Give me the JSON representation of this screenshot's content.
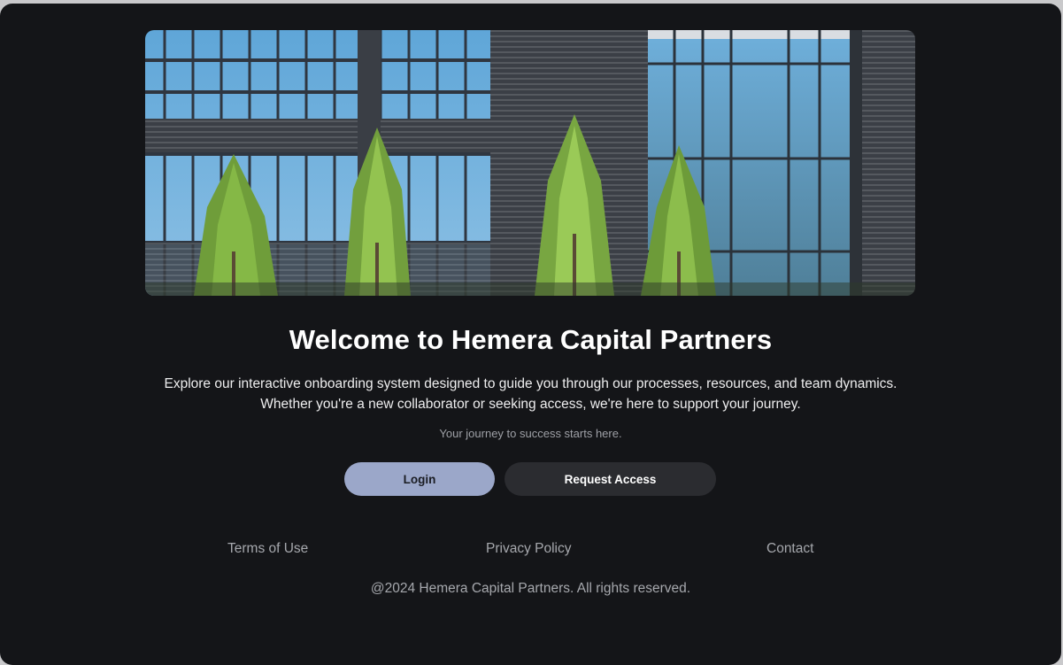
{
  "hero": {
    "image_description": "building-facade-with-trees"
  },
  "main": {
    "title": "Welcome to Hemera Capital Partners",
    "description_line1": "Explore our interactive onboarding system designed to guide you through our processes, resources, and team dynamics.",
    "description_line2": "Whether you're a new collaborator or seeking access, we're here to support your journey.",
    "tagline": "Your journey to success starts here."
  },
  "actions": {
    "login_label": "Login",
    "request_access_label": "Request Access"
  },
  "footer": {
    "links": [
      {
        "label": "Terms of Use"
      },
      {
        "label": "Privacy Policy"
      },
      {
        "label": "Contact"
      }
    ],
    "copyright": "@2024 Hemera Capital Partners. All rights reserved."
  },
  "colors": {
    "background": "#141518",
    "login_button": "#9ba7c9",
    "request_button": "#2b2c30",
    "muted_text": "#a6a8ad"
  }
}
